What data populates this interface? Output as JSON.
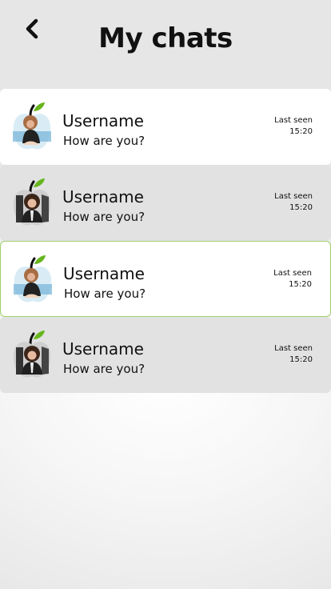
{
  "header": {
    "title": "My chats",
    "back_icon": "chevron-left-icon"
  },
  "chats": [
    {
      "username": "Username",
      "preview": "How are you?",
      "last_seen_label": "Last seen",
      "last_seen_time": "15:20",
      "avatar_icon": "apple-avatar-icon"
    },
    {
      "username": "Username",
      "preview": "How are you?",
      "last_seen_label": "Last seen",
      "last_seen_time": "15:20",
      "avatar_icon": "apple-avatar-icon"
    },
    {
      "username": "Username",
      "preview": "How are you?",
      "last_seen_label": "Last seen",
      "last_seen_time": "15:20",
      "avatar_icon": "apple-avatar-icon"
    },
    {
      "username": "Username",
      "preview": "How are you?",
      "last_seen_label": "Last seen",
      "last_seen_time": "15:20",
      "avatar_icon": "apple-avatar-icon"
    }
  ],
  "colors": {
    "leaf": "#66b51d",
    "selected_border": "#9fd16b",
    "row_light": "#ffffff",
    "row_dark": "#e2e2e2"
  }
}
